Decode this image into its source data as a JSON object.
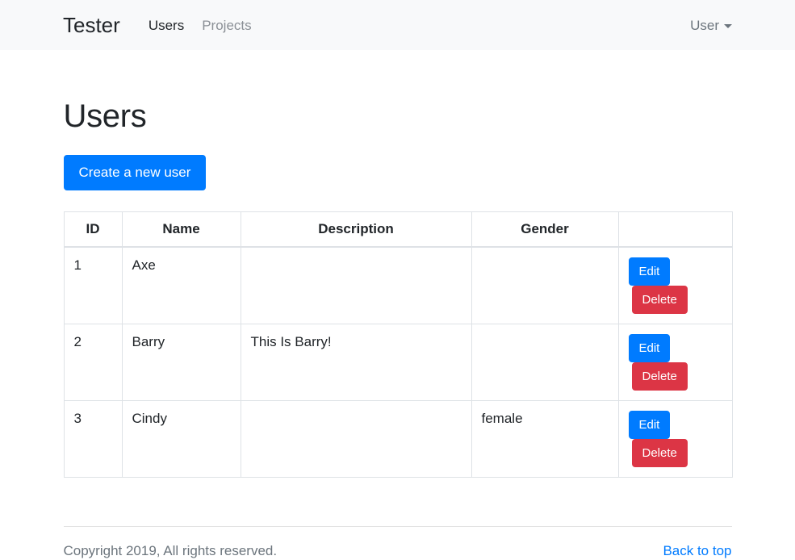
{
  "navbar": {
    "brand": "Tester",
    "links": [
      {
        "label": "Users",
        "state": "active"
      },
      {
        "label": "Projects",
        "state": "muted"
      }
    ],
    "user_menu": {
      "label": "User",
      "icon": "caret-down-icon"
    }
  },
  "main": {
    "page_title": "Users",
    "create_button": "Create a new user",
    "table": {
      "columns": [
        "ID",
        "Name",
        "Description",
        "Gender",
        ""
      ],
      "rows": [
        {
          "id": "1",
          "name": "Axe",
          "description": "",
          "gender": "",
          "edit_label": "Edit",
          "delete_label": "Delete"
        },
        {
          "id": "2",
          "name": "Barry",
          "description": "This Is Barry!",
          "gender": "",
          "edit_label": "Edit",
          "delete_label": "Delete"
        },
        {
          "id": "3",
          "name": "Cindy",
          "description": "",
          "gender": "female",
          "edit_label": "Edit",
          "delete_label": "Delete"
        }
      ]
    }
  },
  "footer": {
    "copyright": "Copyright 2019, All rights reserved.",
    "back_to_top": "Back to top"
  },
  "colors": {
    "primary": "#007bff",
    "danger": "#dc3545",
    "navbar_bg": "#f8f9fa",
    "text": "#212529",
    "muted": "#6c757d",
    "border": "#dee2e6"
  }
}
